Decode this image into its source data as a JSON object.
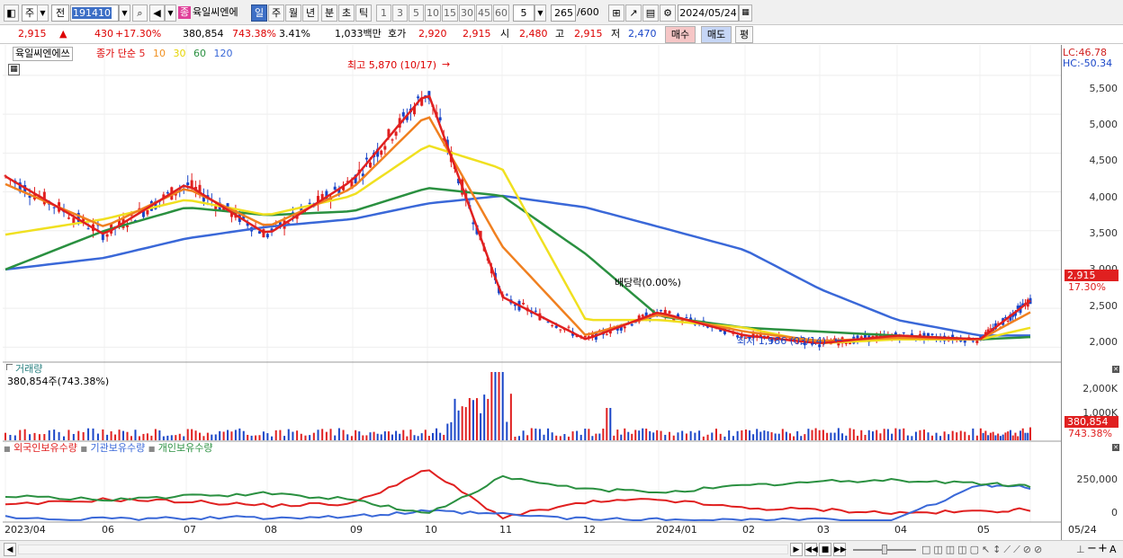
{
  "toolbar": {
    "period_1": "주",
    "period_2": "전",
    "code": "191410",
    "stock_badge": "종",
    "stock_name": "육일씨엔에",
    "periods": [
      "일",
      "주",
      "월",
      "년",
      "분",
      "초",
      "틱"
    ],
    "numbers": [
      "1",
      "3",
      "5",
      "10",
      "15",
      "30",
      "45",
      "60"
    ],
    "interval": "5",
    "count": "265",
    "count_max": "/600",
    "date": "2024/05/24"
  },
  "quote": {
    "price": "2,915",
    "change": "430",
    "change_pct": "+17.30%",
    "volume": "380,854",
    "volume_pct": "743.38%",
    "turnover_pct": "3.41%",
    "amount": "1,033백만",
    "hoga_label": "호가",
    "ask": "2,920",
    "bid": "2,915",
    "open_label": "시",
    "open": "2,480",
    "high_label": "고",
    "high": "2,915",
    "low_label": "저",
    "low": "2,470",
    "buy": "매수",
    "sell": "매도",
    "eval": "평"
  },
  "price_pane": {
    "name": "육일씨엔에쓰",
    "ma_label": "종가 단순",
    "ma": [
      {
        "name": "5",
        "color": "#e02020"
      },
      {
        "name": "10",
        "color": "#f08020"
      },
      {
        "name": "30",
        "color": "#f0e020"
      },
      {
        "name": "60",
        "color": "#2a9040"
      },
      {
        "name": "120",
        "color": "#3a68d8"
      }
    ],
    "high_annot": "최고 5,870 (10/17)",
    "low_annot": "최저 1,986 (03/14)",
    "div_annot": "배당락(0.00%)",
    "lc": "LC:46.78",
    "hc": "HC:-50.34",
    "yticks": [
      "5,500",
      "5,000",
      "4,500",
      "4,000",
      "3,500",
      "3,000",
      "2,500",
      "2,000"
    ],
    "last_price": "2,915",
    "last_pct": "17.30%"
  },
  "volume_pane": {
    "title": "거래량",
    "value": "380,854주(743.38%)",
    "yticks": [
      "2,000K",
      "1,000K"
    ],
    "last": "380,854",
    "last_pct": "743.38%"
  },
  "holdings_pane": {
    "series": [
      {
        "name": "외국인보유수량",
        "color": "#e02020"
      },
      {
        "name": "기관보유수량",
        "color": "#3a68d8"
      },
      {
        "name": "개인보유수량",
        "color": "#2a9040"
      }
    ],
    "yticks": [
      "250,000",
      "0"
    ]
  },
  "xlabels": [
    "2023/04",
    "06",
    "07",
    "08",
    "09",
    "10",
    "11",
    "12",
    "2024/01",
    "02",
    "03",
    "04",
    "05",
    "05/24"
  ],
  "colors": {
    "up": "#e02020",
    "down": "#1a46c8",
    "ma5": "#e02020",
    "ma10": "#f08020",
    "ma30": "#f0e020",
    "ma60": "#2a9040",
    "ma120": "#3a68d8"
  },
  "chart_data": {
    "type": "line",
    "title": "",
    "x": [
      "2023/04",
      "06",
      "07",
      "08",
      "09",
      "10",
      "11",
      "12",
      "2024/01",
      "02",
      "03",
      "04",
      "05",
      "05/24"
    ],
    "ylabel": "",
    "ylim": [
      1900,
      5800
    ],
    "series": [
      {
        "name": "5",
        "values": [
          4200,
          3450,
          4100,
          3450,
          4150,
          5300,
          2650,
          2100,
          2450,
          2150,
          2050,
          2150,
          2100,
          2600
        ]
      },
      {
        "name": "10",
        "values": [
          4100,
          3550,
          4050,
          3550,
          4050,
          5000,
          3300,
          2150,
          2420,
          2200,
          2080,
          2120,
          2100,
          2450
        ]
      },
      {
        "name": "30",
        "values": [
          3450,
          3650,
          3900,
          3700,
          3950,
          4600,
          4300,
          2350,
          2350,
          2250,
          2050,
          2100,
          2100,
          2250
        ]
      },
      {
        "name": "60",
        "values": [
          3000,
          3500,
          3800,
          3700,
          3750,
          4050,
          3950,
          3200,
          2400,
          2250,
          2200,
          2150,
          2100,
          2130
        ]
      },
      {
        "name": "120",
        "values": [
          3000,
          3150,
          3400,
          3550,
          3650,
          3850,
          3950,
          3800,
          3550,
          3250,
          2750,
          2350,
          2150,
          2150
        ]
      }
    ]
  }
}
